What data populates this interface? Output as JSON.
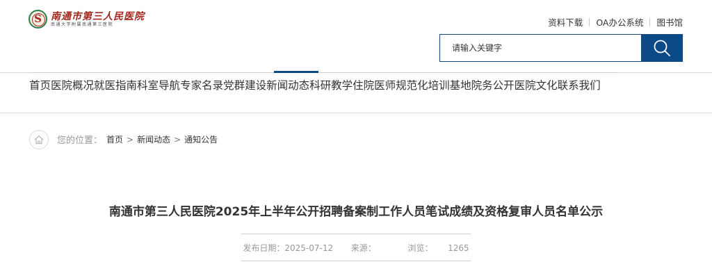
{
  "header": {
    "logo_title": "南通市第三人民医院",
    "logo_subtitle": "南通大学附属南通第三医院",
    "top_links": [
      "资料下载",
      "OA办公系统",
      "图书馆"
    ],
    "search_placeholder": "请输入关键字",
    "accent_color": "#0c4a87"
  },
  "nav": {
    "items": [
      "首页",
      "医院概况",
      "就医指南",
      "科室导航",
      "专家名录",
      "党群建设",
      "新闻动态",
      "科研教学",
      "住院医师规范化培训基地",
      "院务公开",
      "医院文化",
      "联系我们"
    ],
    "active": "新闻动态"
  },
  "breadcrumb": {
    "label": "您的位置：",
    "items": [
      "首页",
      "新闻动态",
      "通知公告"
    ],
    "separator": ">"
  },
  "article": {
    "title": "南通市第三人民医院2025年上半年公开招聘备案制工作人员笔试成绩及资格复审人员名单公示",
    "date_label": "发布日期：",
    "date": "2025-07-12",
    "source_label": "来源：",
    "source": "",
    "views_label": "浏览：",
    "views": "1265"
  }
}
